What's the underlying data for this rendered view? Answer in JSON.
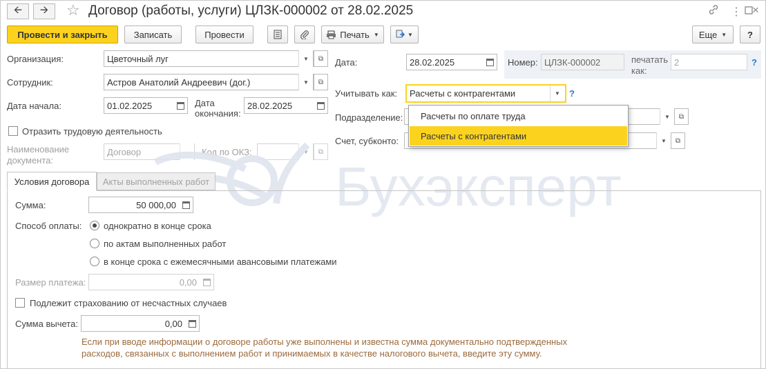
{
  "window": {
    "title": "Договор (работы, услуги) ЦЛЗК-000002 от 28.02.2025",
    "back_icon": "arrow-left-icon",
    "forward_icon": "arrow-right-icon",
    "favorite_icon": "star-icon",
    "link_icon": "link-icon",
    "menu_icon": "more-vertical-icon",
    "maximize_icon": "maximize-icon",
    "close_icon": "close-icon"
  },
  "toolbar": {
    "post_close_label": "Провести и закрыть",
    "save_label": "Записать",
    "post_label": "Провести",
    "print_label": "Печать",
    "more_label": "Еще",
    "help_label": "?"
  },
  "form": {
    "org_label": "Организация:",
    "org_value": "Цветочный луг",
    "employee_label": "Сотрудник:",
    "employee_value": "Астров Анатолий Андреевич (дог.)",
    "start_label": "Дата начала:",
    "start_value": "01.02.2025",
    "end_label_1": "Дата",
    "end_label_2": "окончания:",
    "end_value": "28.02.2025",
    "labor_check_label": "Отразить трудовую деятельность",
    "docname_label_1": "Наименование",
    "docname_label_2": "документа:",
    "docname_value": "Договор",
    "okz_label": "Код по ОКЗ:",
    "date_label": "Дата:",
    "date_value": "28.02.2025",
    "number_label": "Номер:",
    "number_value": "ЦЛЗК-000002",
    "print_as_label_1": "печатать",
    "print_as_label_2": "как:",
    "print_as_value": "2",
    "account_as_label": "Учитывать как:",
    "account_as_value": "Расчеты с контрагентами",
    "division_label": "Подразделение:",
    "subconto_label": "Счет, субконто:",
    "help_q": "?"
  },
  "dropdown": {
    "options": [
      "Расчеты по оплате труда",
      "Расчеты с контрагентами"
    ],
    "selected_index": 1
  },
  "tabs": [
    "Условия договора",
    "Акты выполненных работ"
  ],
  "terms": {
    "sum_label": "Сумма:",
    "sum_value": "50 000,00",
    "payment_label": "Способ оплаты:",
    "payment_options": [
      "однократно в конце срока",
      "по актам выполненных работ",
      "в конце срока с ежемесячными авансовыми платежами"
    ],
    "payment_selected": 0,
    "payment_size_label": "Размер платежа:",
    "payment_size_value": "0,00",
    "insurance_label": "Подлежит страхованию от несчастных случаев",
    "deduction_label": "Сумма вычета:",
    "deduction_value": "0,00",
    "note_line1": "Если при вводе информации о договоре работы уже выполнены и известна сумма документально подтвержденных",
    "note_line2": "расходов, связанных с выполнением работ и принимаемых в качестве налогового вычета, введите эту сумму."
  },
  "watermark": {
    "text": "Бухэксперт"
  },
  "colors": {
    "accent": "#fbd31f",
    "link": "#2a78c8",
    "note": "#9b6a3c"
  }
}
